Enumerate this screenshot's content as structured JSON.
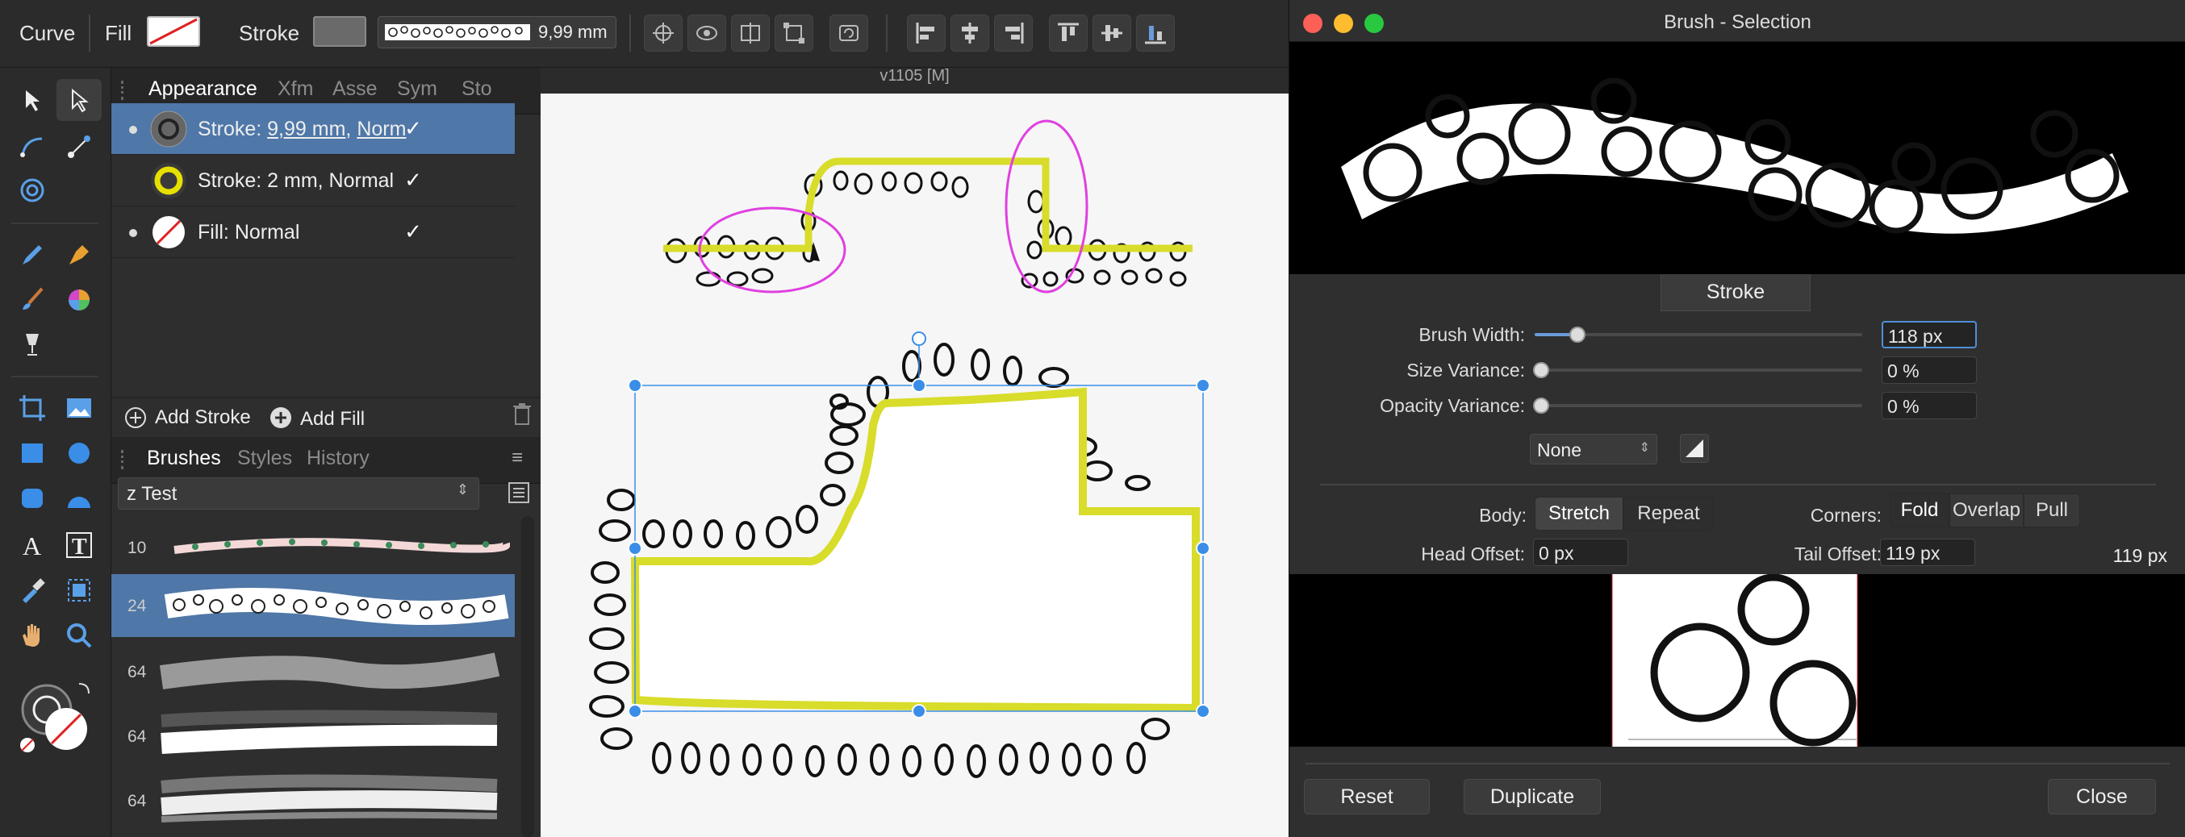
{
  "context_bar": {
    "tool_name": "Curve",
    "fill_label": "Fill",
    "stroke_label": "Stroke",
    "stroke_width": "9,99 mm"
  },
  "panel_tabs": [
    "Appearance",
    "Xfm",
    "Asse",
    "Sym",
    "Sto"
  ],
  "appearance": {
    "rows": [
      {
        "prefix": "Stroke: ",
        "width": "9,99 mm",
        "sep": ", ",
        "blend": "Norm"
      },
      {
        "label": "Stroke: 2 mm, Normal"
      },
      {
        "label": "Fill: Normal"
      }
    ],
    "check": "✓",
    "add_stroke": "Add Stroke",
    "add_fill": "Add Fill"
  },
  "lower_tabs": [
    "Brushes",
    "Styles",
    "History"
  ],
  "brush_category": "z Test",
  "brushes": [
    {
      "size": "10"
    },
    {
      "size": "24"
    },
    {
      "size": "64"
    },
    {
      "size": "64"
    },
    {
      "size": "64"
    }
  ],
  "document": {
    "title": "v1105  [M]"
  },
  "dialog": {
    "title": "Brush - Selection",
    "section_tab": "Stroke",
    "brush_width_label": "Brush Width:",
    "brush_width_value": "118 px",
    "brush_width_fraction": 0.13,
    "size_variance_label": "Size Variance:",
    "size_variance_value": "0 %",
    "opacity_variance_label": "Opacity Variance:",
    "opacity_variance_value": "0 %",
    "pressure_select": "None",
    "body_label": "Body:",
    "body_options": [
      "Stretch",
      "Repeat"
    ],
    "corners_label": "Corners:",
    "corner_options": [
      "Fold",
      "Overlap",
      "Pull"
    ],
    "head_offset_label": "Head Offset:",
    "head_offset_value": "0 px",
    "tail_offset_label": "Tail Offset:",
    "tail_offset_value": "119 px",
    "texture_width": "119 px",
    "buttons": {
      "reset": "Reset",
      "duplicate": "Duplicate",
      "close": "Close"
    }
  },
  "colors": {
    "accent": "#4f77a8",
    "selection_yellow": "#d8dc2a",
    "magenta": "#e040e0"
  }
}
